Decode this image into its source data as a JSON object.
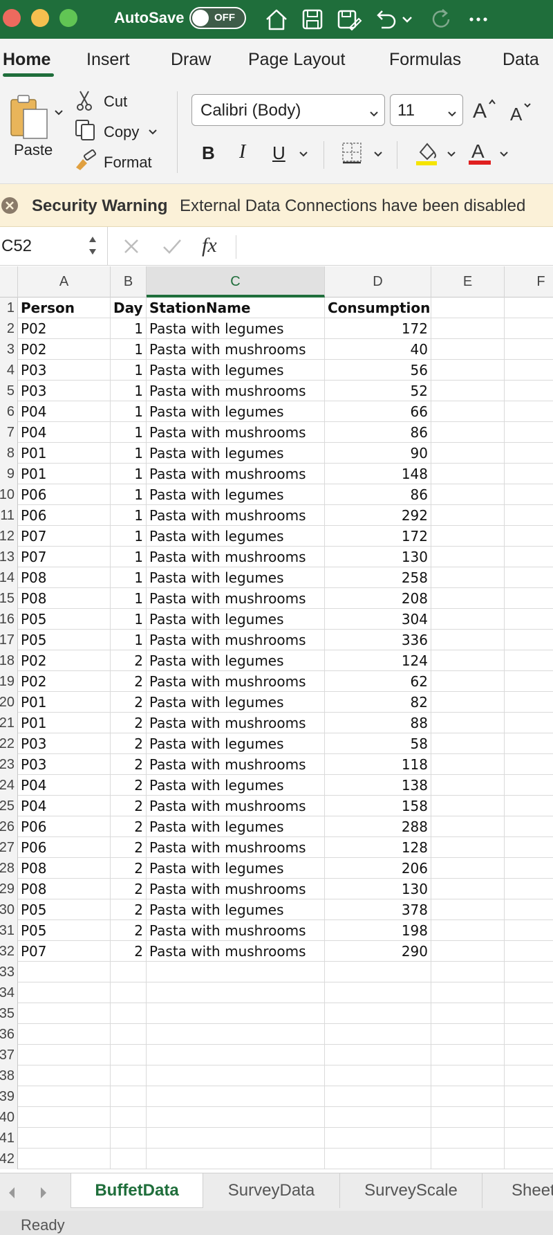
{
  "titlebar": {
    "autosave_label": "AutoSave",
    "autosave_state": "OFF",
    "icons": [
      "home-icon",
      "save-icon",
      "edit-save-icon",
      "undo-icon",
      "redo-icon",
      "more-icon"
    ]
  },
  "ribbon_tabs": [
    "Home",
    "Insert",
    "Draw",
    "Page Layout",
    "Formulas",
    "Data"
  ],
  "ribbon": {
    "paste_label": "Paste",
    "cut_label": "Cut",
    "copy_label": "Copy",
    "format_label": "Format",
    "font_name": "Calibri (Body)",
    "font_size": "11",
    "bold_label": "B",
    "italic_label": "I",
    "underline_label": "U",
    "font_color_label": "A"
  },
  "security": {
    "title": "Security Warning",
    "message": "External Data Connections have been disabled"
  },
  "formula_bar": {
    "name_box": "C52",
    "fx_label": "fx",
    "formula": ""
  },
  "columns": [
    "A",
    "B",
    "C",
    "D",
    "E",
    "F"
  ],
  "row_numbers": [
    "1",
    "2",
    "3",
    "4",
    "5",
    "6",
    "7",
    "8",
    "9",
    "10",
    "11",
    "12",
    "13",
    "14",
    "15",
    "16",
    "17",
    "18",
    "19",
    "20",
    "21",
    "22",
    "23",
    "24",
    "25",
    "26",
    "27",
    "28",
    "29",
    "30",
    "31",
    "32",
    "33",
    "34",
    "35",
    "36",
    "37",
    "38",
    "39",
    "40",
    "41",
    "42"
  ],
  "table": {
    "headers": [
      "Person",
      "Day",
      "StationName",
      "Consumption"
    ],
    "rows": [
      [
        "P02",
        "1",
        "Pasta with legumes",
        "172"
      ],
      [
        "P02",
        "1",
        "Pasta with mushrooms",
        "40"
      ],
      [
        "P03",
        "1",
        "Pasta with legumes",
        "56"
      ],
      [
        "P03",
        "1",
        "Pasta with mushrooms",
        "52"
      ],
      [
        "P04",
        "1",
        "Pasta with legumes",
        "66"
      ],
      [
        "P04",
        "1",
        "Pasta with mushrooms",
        "86"
      ],
      [
        "P01",
        "1",
        "Pasta with legumes",
        "90"
      ],
      [
        "P01",
        "1",
        "Pasta with mushrooms",
        "148"
      ],
      [
        "P06",
        "1",
        "Pasta with legumes",
        "86"
      ],
      [
        "P06",
        "1",
        "Pasta with mushrooms",
        "292"
      ],
      [
        "P07",
        "1",
        "Pasta with legumes",
        "172"
      ],
      [
        "P07",
        "1",
        "Pasta with mushrooms",
        "130"
      ],
      [
        "P08",
        "1",
        "Pasta with legumes",
        "258"
      ],
      [
        "P08",
        "1",
        "Pasta with mushrooms",
        "208"
      ],
      [
        "P05",
        "1",
        "Pasta with legumes",
        "304"
      ],
      [
        "P05",
        "1",
        "Pasta with mushrooms",
        "336"
      ],
      [
        "P02",
        "2",
        "Pasta with legumes",
        "124"
      ],
      [
        "P02",
        "2",
        "Pasta with mushrooms",
        "62"
      ],
      [
        "P01",
        "2",
        "Pasta with legumes",
        "82"
      ],
      [
        "P01",
        "2",
        "Pasta with mushrooms",
        "88"
      ],
      [
        "P03",
        "2",
        "Pasta with legumes",
        "58"
      ],
      [
        "P03",
        "2",
        "Pasta with mushrooms",
        "118"
      ],
      [
        "P04",
        "2",
        "Pasta with legumes",
        "138"
      ],
      [
        "P04",
        "2",
        "Pasta with mushrooms",
        "158"
      ],
      [
        "P06",
        "2",
        "Pasta with legumes",
        "288"
      ],
      [
        "P06",
        "2",
        "Pasta with mushrooms",
        "128"
      ],
      [
        "P08",
        "2",
        "Pasta with legumes",
        "206"
      ],
      [
        "P08",
        "2",
        "Pasta with mushrooms",
        "130"
      ],
      [
        "P05",
        "2",
        "Pasta with legumes",
        "378"
      ],
      [
        "P05",
        "2",
        "Pasta with mushrooms",
        "198"
      ],
      [
        "P07",
        "2",
        "Pasta with mushrooms",
        "290"
      ]
    ]
  },
  "sheet_tabs": [
    "BuffetData",
    "SurveyData",
    "SurveyScale",
    "Sheet"
  ],
  "active_sheet": "BuffetData",
  "status": "Ready",
  "colors": {
    "accent": "#1f6e3b",
    "security_bg": "#fbf1d8",
    "highlight_yellow": "#f5e400",
    "font_red": "#e02020"
  }
}
